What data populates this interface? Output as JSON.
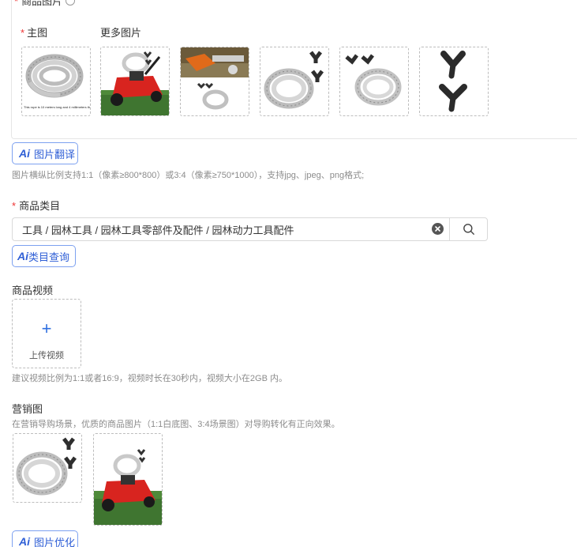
{
  "product_images": {
    "title": "商品图片",
    "main_label": "主图",
    "more_label": "更多图片",
    "thumbnails": [
      {
        "caption": "This rope is 10 meters long and 4 millimeters thick"
      },
      {
        "caption": ""
      },
      {
        "caption": ""
      },
      {
        "caption": ""
      },
      {
        "caption": ""
      },
      {
        "caption": ""
      }
    ],
    "translate_button": "图片翻译",
    "hint": "图片横纵比例支持1:1（像素≥800*800）或3:4（像素≥750*1000），支持jpg、jpeg、png格式;"
  },
  "category": {
    "title": "商品类目",
    "value": "工具 / 园林工具 / 园林工具零部件及配件 / 园林动力工具配件",
    "clear_icon": "close-circle-icon",
    "search_icon": "search-icon",
    "query_button": "类目查询"
  },
  "video": {
    "title": "商品视频",
    "upload_label": "上传视频",
    "plus_icon": "+",
    "hint": "建议视频比例为1:1或者16:9，视频时长在30秒内，视频大小在2GB 内。"
  },
  "marketing": {
    "title": "营销图",
    "hint": "在营销导购场景，优质的商品图片（1:1白底图、3:4场景图）对导购转化有正向效果。",
    "optimize_button": "图片优化"
  },
  "ai_badge": "Ai",
  "colors": {
    "accent": "#2f5fd6",
    "required": "#e33333",
    "hint": "#8c8c8c",
    "border": "#d9d9d9"
  }
}
